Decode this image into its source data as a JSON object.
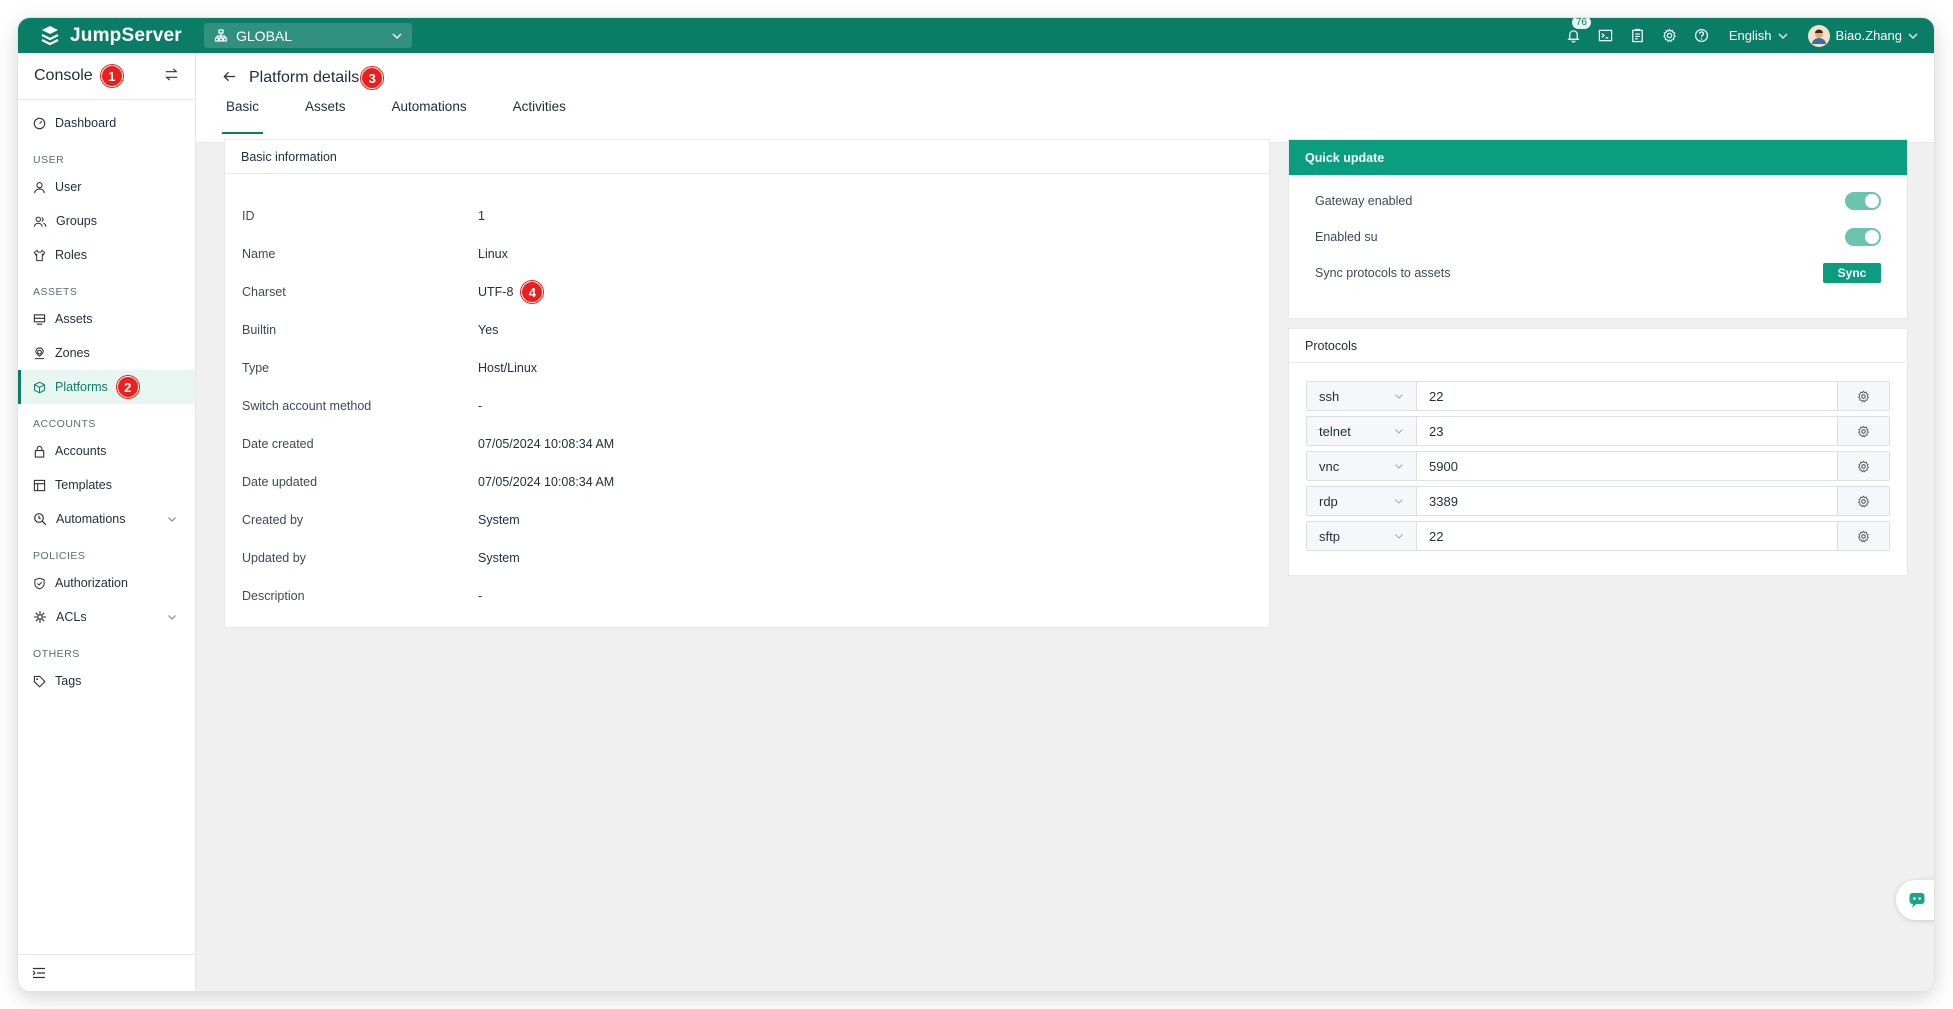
{
  "app": {
    "brand": "JumpServer"
  },
  "org": {
    "label": "GLOBAL"
  },
  "topbar": {
    "notification_count": "76",
    "language": "English",
    "username": "Biao.Zhang"
  },
  "sidebar": {
    "title": "Console",
    "title_badge": "1",
    "groups": {
      "user": "USER",
      "assets": "ASSETS",
      "accounts": "ACCOUNTS",
      "policies": "POLICIES",
      "others": "OTHERS"
    },
    "items": {
      "dashboard": "Dashboard",
      "user": "User",
      "groups": "Groups",
      "roles": "Roles",
      "assets": "Assets",
      "zones": "Zones",
      "platforms": "Platforms",
      "accounts": "Accounts",
      "templates": "Templates",
      "automations": "Automations",
      "authorization": "Authorization",
      "acls": "ACLs",
      "tags": "Tags"
    },
    "platforms_badge": "2"
  },
  "header": {
    "title": "Platform details",
    "title_badge": "3",
    "tabs": [
      "Basic",
      "Assets",
      "Automations",
      "Activities"
    ]
  },
  "basic_info": {
    "title": "Basic information",
    "charset_badge": "4",
    "rows": [
      {
        "key": "ID",
        "value": "1"
      },
      {
        "key": "Name",
        "value": "Linux"
      },
      {
        "key": "Charset",
        "value": "UTF-8"
      },
      {
        "key": "Builtin",
        "value": "Yes"
      },
      {
        "key": "Type",
        "value": "Host/Linux"
      },
      {
        "key": "Switch account method",
        "value": "-"
      },
      {
        "key": "Date created",
        "value": "07/05/2024 10:08:34 AM"
      },
      {
        "key": "Date updated",
        "value": "07/05/2024 10:08:34 AM"
      },
      {
        "key": "Created by",
        "value": "System"
      },
      {
        "key": "Updated by",
        "value": "System"
      },
      {
        "key": "Description",
        "value": "-"
      }
    ]
  },
  "quick_update": {
    "title": "Quick update",
    "gateway_label": "Gateway enabled",
    "gateway_on": true,
    "su_label": "Enabled su",
    "su_on": true,
    "sync_label": "Sync protocols to assets",
    "sync_button": "Sync"
  },
  "protocols": {
    "title": "Protocols",
    "items": [
      {
        "name": "ssh",
        "port": "22"
      },
      {
        "name": "telnet",
        "port": "23"
      },
      {
        "name": "vnc",
        "port": "5900"
      },
      {
        "name": "rdp",
        "port": "3389"
      },
      {
        "name": "sftp",
        "port": "22"
      }
    ]
  },
  "colors": {
    "brand": "#0a7d66",
    "accent": "#0a9d80",
    "annotation": "#e8211f"
  }
}
